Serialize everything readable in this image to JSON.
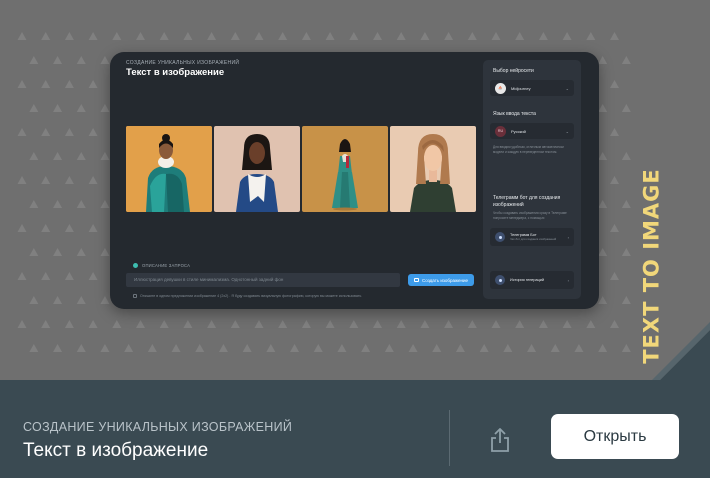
{
  "hero": {
    "vertical_title": "TEXT TO IMAGE",
    "accent_color": "#f1d77a"
  },
  "app": {
    "subtitle": "СОЗДАНИЕ УНИКАЛЬНЫХ ИЗОБРАЖЕНИЙ",
    "title": "Текст в изображение",
    "thumbnails": [
      {
        "name": "woman-bun-teal-coat",
        "bg": "#e2a04a"
      },
      {
        "name": "woman-scarf-blue-coat",
        "bg": "#e0c2b0"
      },
      {
        "name": "woman-teal-dress",
        "bg": "#c89248"
      },
      {
        "name": "woman-green-sweater",
        "bg": "#e9cbb2"
      }
    ],
    "prompt": {
      "label": "ОПИСАНИЕ ЗАПРОСА",
      "placeholder": "Иллюстрация девушки в стиле минимализма. Однотонный задний фон",
      "button_label": "Создать изображение",
      "hint": "Опишите в одном предложении изображение 4 (2x2) . Я буду создавать визуальную фотографию, которую вы можете использовать"
    },
    "side": {
      "network_heading": "Выбор нейросети",
      "network_value": "Midjourney",
      "language_heading": "Язык ввода текста",
      "language_badge": "RU",
      "language_value": "Русский",
      "language_note": "Для вводим удобным, отличным автоматически модели и каждую в переведенном текстом.",
      "bot_heading": "Телеграмм бот для создания изображений",
      "bot_note": "Чтобы создавать изображения сразу в Телеграме попросите менеджера, с помощью",
      "bot_item_title": "Телеграмм Бот",
      "bot_item_sub": "Чат-бот для создания изображений",
      "history_item_title": "История генераций"
    }
  },
  "info": {
    "subtitle": "СОЗДАНИЕ УНИКАЛЬНЫХ ИЗОБРАЖЕНИЙ",
    "title": "Текст в изображение",
    "open_label": "Открыть"
  }
}
